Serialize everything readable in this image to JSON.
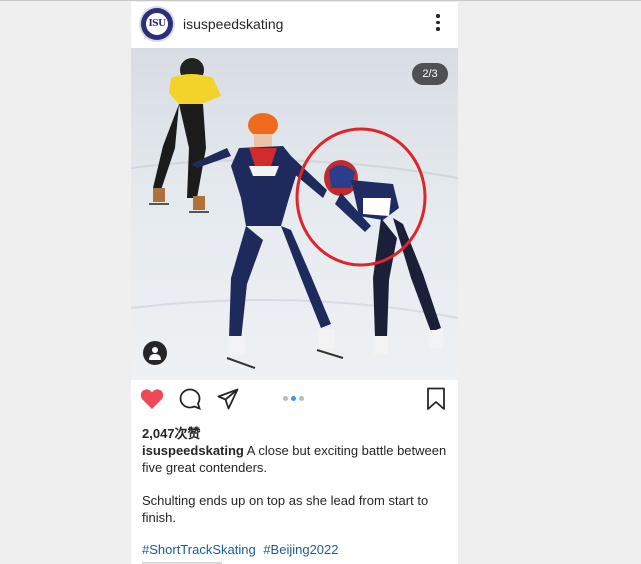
{
  "post": {
    "username": "isuspeedskating",
    "avatar_text": "ISU",
    "image_counter": "2/3",
    "likes": "2,047次赞",
    "caption_user": "isuspeedskating",
    "caption_text": " A close but exciting battle between five great contenders.",
    "paragraph2": "Schulting ends up on top as she lead from start to finish.",
    "hashtags": [
      "#ShortTrackSkating",
      "#Beijing2022"
    ]
  },
  "icons": {
    "more": "more-options-icon",
    "heart": "heart-icon",
    "comment": "comment-icon",
    "share": "send-icon",
    "bookmark": "bookmark-icon",
    "tag": "person-tag-icon"
  },
  "colors": {
    "heart": "#ed4956",
    "hashtag": "#1a5e8f",
    "highlight_circle": "#e0242c",
    "dot_active": "#3897f0"
  }
}
